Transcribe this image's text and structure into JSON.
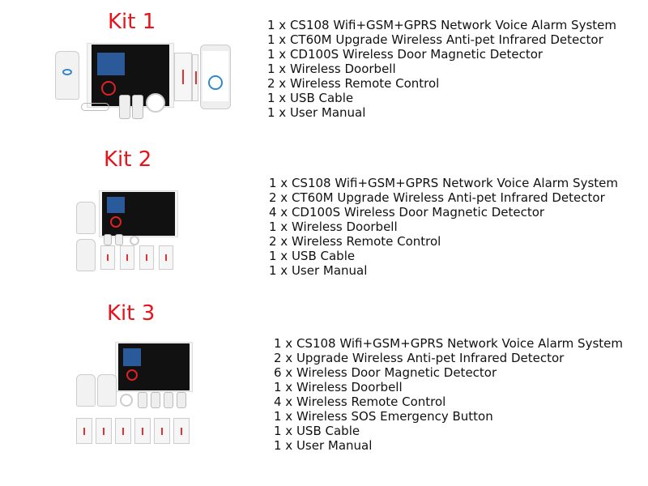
{
  "kits": [
    {
      "title": "Kit 1",
      "items": [
        "1 x CS108 Wifi+GSM+GPRS Network Voice Alarm System",
        "1 x CT60M Upgrade Wireless Anti-pet Infrared Detector",
        "1 x CD100S Wireless Door Magnetic Detector",
        "1 x Wireless Doorbell",
        "2 x Wireless Remote Control",
        "1 x USB Cable",
        "1 x User Manual"
      ]
    },
    {
      "title": "Kit 2",
      "items": [
        "1 x CS108 Wifi+GSM+GPRS Network Voice Alarm System",
        "2 x CT60M Upgrade Wireless Anti-pet Infrared Detector",
        "4 x CD100S Wireless Door Magnetic Detector",
        "1 x Wireless Doorbell",
        "2 x Wireless Remote Control",
        "1 x USB Cable",
        "1 x User Manual"
      ]
    },
    {
      "title": "Kit 3",
      "items": [
        "1 x CS108 Wifi+GSM+GPRS Network Voice Alarm System",
        "2 x Upgrade Wireless Anti-pet Infrared Detector",
        "6 x Wireless Door Magnetic Detector",
        "1 x Wireless Doorbell",
        "4 x Wireless Remote Control",
        "1 x Wireless SOS Emergency Button",
        "1 x USB Cable",
        "1 x User Manual"
      ]
    }
  ],
  "colors": {
    "title": "#e8141c",
    "text": "#111111"
  }
}
